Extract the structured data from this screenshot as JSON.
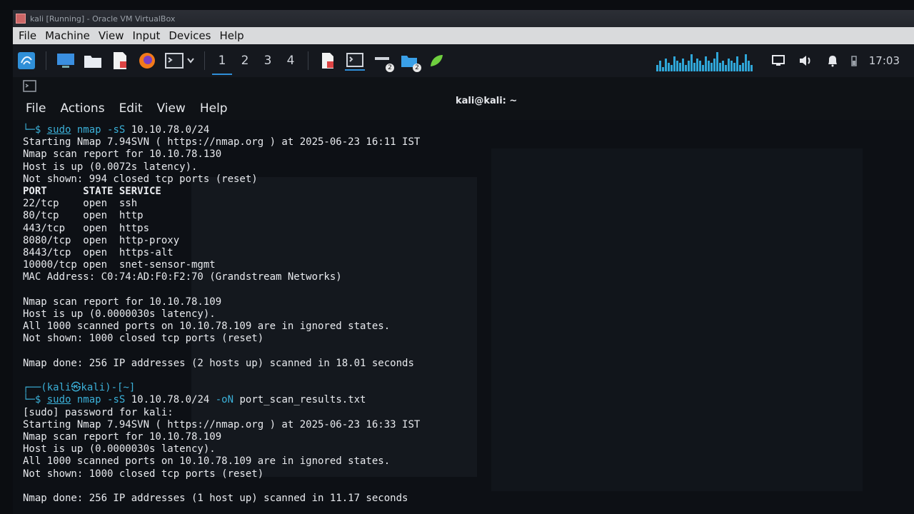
{
  "window": {
    "title": "kali [Running] - Oracle VM VirtualBox",
    "menu": [
      "File",
      "Machine",
      "View",
      "Input",
      "Devices",
      "Help"
    ]
  },
  "panel": {
    "workspaces": [
      "1",
      "2",
      "3",
      "4"
    ],
    "active_workspace": "1",
    "badges": [
      "2",
      "2"
    ],
    "clock": "17:03",
    "cpu_levels": [
      0.3,
      0.5,
      0.2,
      0.6,
      0.4,
      0.3,
      0.7,
      0.5,
      0.4,
      0.6,
      0.3,
      0.5,
      0.8,
      0.4,
      0.6,
      0.5,
      0.3,
      0.7,
      0.5,
      0.4,
      0.6,
      0.9,
      0.4,
      0.5,
      0.3,
      0.6,
      0.5,
      0.4,
      0.7,
      0.3,
      0.4,
      0.8,
      0.5,
      0.3
    ],
    "accent": "#2f8fd8"
  },
  "terminal": {
    "title": "kali@kali: ~",
    "menu": [
      "File",
      "Actions",
      "Edit",
      "View",
      "Help"
    ],
    "lines": [
      {
        "type": "cmd",
        "prefix": "└─$ ",
        "sudo": "sudo",
        "cmd": " nmap",
        "flag": " -sS",
        "args": " 10.10.78.0/24"
      },
      {
        "type": "text",
        "text": "Starting Nmap 7.94SVN ( https://nmap.org ) at 2025-06-23 16:11 IST"
      },
      {
        "type": "text",
        "text": "Nmap scan report for 10.10.78.130"
      },
      {
        "type": "text",
        "text": "Host is up (0.0072s latency)."
      },
      {
        "type": "text",
        "text": "Not shown: 994 closed tcp ports (reset)"
      },
      {
        "type": "text",
        "text": "PORT      STATE SERVICE",
        "bold": true
      },
      {
        "type": "text",
        "text": "22/tcp    open  ssh"
      },
      {
        "type": "text",
        "text": "80/tcp    open  http"
      },
      {
        "type": "text",
        "text": "443/tcp   open  https"
      },
      {
        "type": "text",
        "text": "8080/tcp  open  http-proxy"
      },
      {
        "type": "text",
        "text": "8443/tcp  open  https-alt"
      },
      {
        "type": "text",
        "text": "10000/tcp open  snet-sensor-mgmt"
      },
      {
        "type": "text",
        "text": "MAC Address: C0:74:AD:F0:F2:70 (Grandstream Networks)"
      },
      {
        "type": "text",
        "text": ""
      },
      {
        "type": "text",
        "text": "Nmap scan report for 10.10.78.109"
      },
      {
        "type": "text",
        "text": "Host is up (0.0000030s latency)."
      },
      {
        "type": "text",
        "text": "All 1000 scanned ports on 10.10.78.109 are in ignored states."
      },
      {
        "type": "text",
        "text": "Not shown: 1000 closed tcp ports (reset)"
      },
      {
        "type": "text",
        "text": ""
      },
      {
        "type": "text",
        "text": "Nmap done: 256 IP addresses (2 hosts up) scanned in 18.01 seconds"
      },
      {
        "type": "text",
        "text": ""
      },
      {
        "type": "prompt",
        "text": "┌──(kali㉿kali)-[~]"
      },
      {
        "type": "cmd",
        "prefix": "└─$ ",
        "sudo": "sudo",
        "cmd": " nmap",
        "flag": " -sS",
        "args": " 10.10.78.0/24",
        "flag2": " -oN",
        "args2": " port_scan_results.txt"
      },
      {
        "type": "text",
        "text": "[sudo] password for kali:"
      },
      {
        "type": "text",
        "text": "Starting Nmap 7.94SVN ( https://nmap.org ) at 2025-06-23 16:33 IST"
      },
      {
        "type": "text",
        "text": "Nmap scan report for 10.10.78.109"
      },
      {
        "type": "text",
        "text": "Host is up (0.0000030s latency)."
      },
      {
        "type": "text",
        "text": "All 1000 scanned ports on 10.10.78.109 are in ignored states."
      },
      {
        "type": "text",
        "text": "Not shown: 1000 closed tcp ports (reset)"
      },
      {
        "type": "text",
        "text": ""
      },
      {
        "type": "text",
        "text": "Nmap done: 256 IP addresses (1 host up) scanned in 11.17 seconds"
      }
    ]
  }
}
